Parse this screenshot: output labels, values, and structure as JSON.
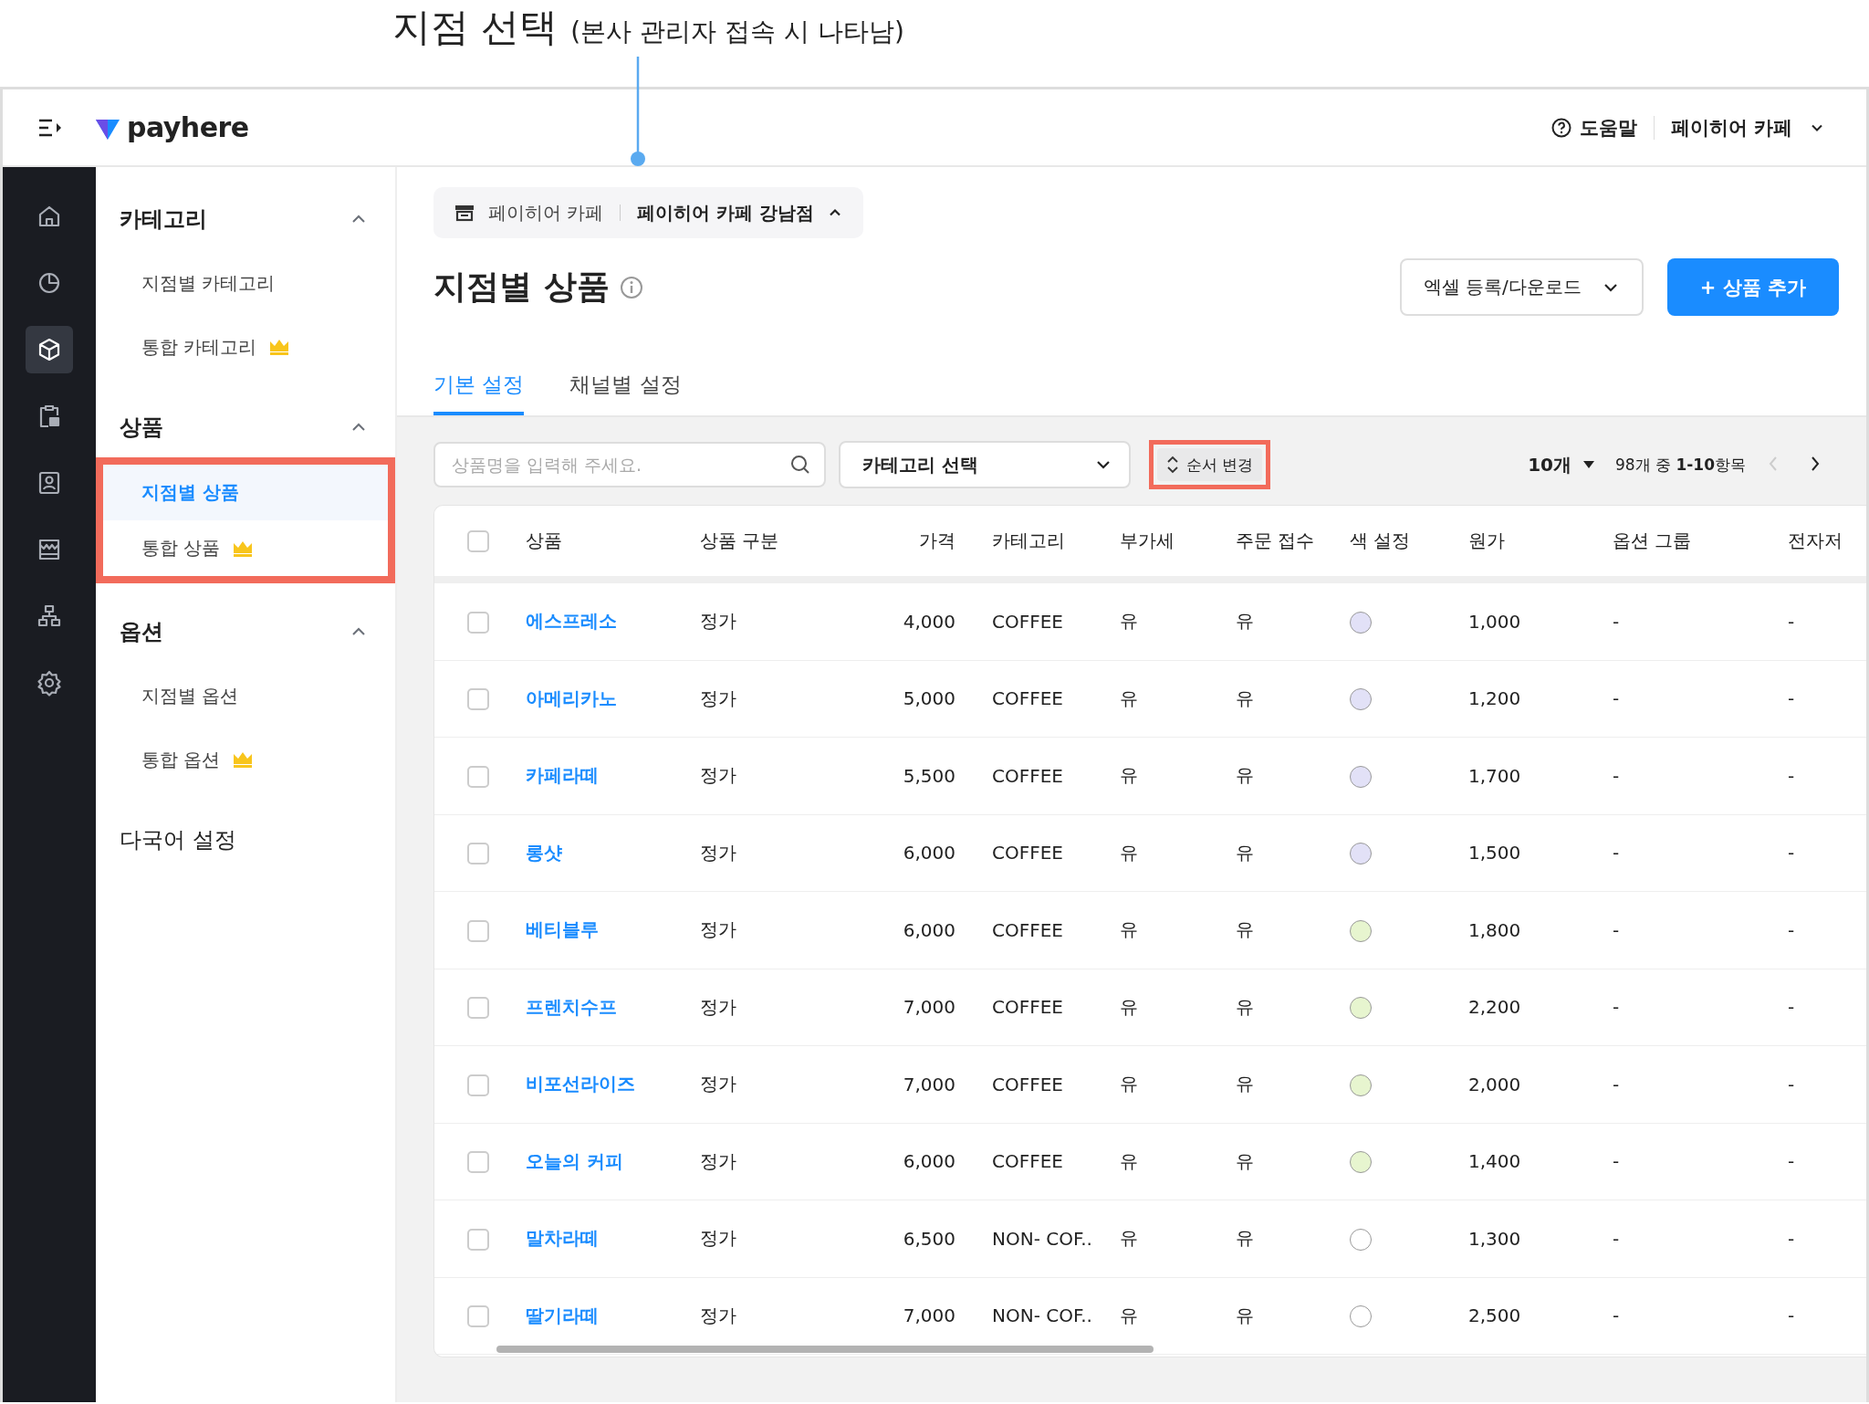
{
  "annotation": {
    "title": "지점 선택",
    "note": "(본사 관리자 접속 시 나타남)"
  },
  "header": {
    "logo": "payhere",
    "help": "도움말",
    "account": "페이히어 카페"
  },
  "rail": [
    {
      "kind": "home",
      "selected": false
    },
    {
      "kind": "chart",
      "selected": false
    },
    {
      "kind": "box",
      "selected": true
    },
    {
      "kind": "clipboard",
      "selected": false
    },
    {
      "kind": "contact",
      "selected": false
    },
    {
      "kind": "store",
      "selected": false
    },
    {
      "kind": "org",
      "selected": false
    },
    {
      "kind": "gear",
      "selected": false
    }
  ],
  "menu": [
    {
      "kind": "group",
      "title": "카테고리",
      "expanded": true,
      "highlighted": false,
      "items": [
        {
          "label": "지점별 카테고리",
          "selected": false,
          "premium": false
        },
        {
          "label": "통합 카테고리",
          "selected": false,
          "premium": true
        }
      ]
    },
    {
      "kind": "group",
      "title": "상품",
      "expanded": true,
      "highlighted": true,
      "items": [
        {
          "label": "지점별 상품",
          "selected": true,
          "premium": false
        },
        {
          "label": "통합 상품",
          "selected": false,
          "premium": true
        }
      ]
    },
    {
      "kind": "group",
      "title": "옵션",
      "expanded": true,
      "highlighted": false,
      "items": [
        {
          "label": "지점별 옵션",
          "selected": false,
          "premium": false
        },
        {
          "label": "통합 옵션",
          "selected": false,
          "premium": true
        }
      ]
    },
    {
      "kind": "link",
      "title": "다국어 설정"
    }
  ],
  "branch_selector": {
    "company": "페이히어 카페",
    "branch": "페이히어 카페 강남점",
    "expanded": true
  },
  "page": {
    "title": "지점별 상품",
    "excel_button": "엑셀 등록/다운로드",
    "add_button": "+ 상품 추가"
  },
  "tabs": [
    {
      "label": "기본 설정",
      "selected": true
    },
    {
      "label": "채널별 설정",
      "selected": false
    }
  ],
  "toolbar": {
    "search": {
      "placeholder": "상품명을 입력해 주세요."
    },
    "category": "카테고리 선택",
    "reorder": {
      "label": "순서 변경",
      "highlighted": true
    },
    "page_size": "10개",
    "range": "98개 중 **1-10**항목",
    "prev_disabled": true,
    "next_disabled": false
  },
  "table": {
    "select_all_checked": false,
    "columns": [
      "상품",
      "상품 구분",
      "가격",
      "카테고리",
      "부가세",
      "주문 접수",
      "색 설정",
      "원가",
      "옵션 그룹",
      "전자저"
    ],
    "rows": [
      {
        "checked": false,
        "name": "에스프레소",
        "type": "정가",
        "price": "4,000",
        "category": "COFFEE",
        "vat": "유",
        "order": "유",
        "color": "#e2e1f7",
        "cost": "1,000",
        "option_group": "-",
        "column_10": "-"
      },
      {
        "checked": false,
        "name": "아메리카노",
        "type": "정가",
        "price": "5,000",
        "category": "COFFEE",
        "vat": "유",
        "order": "유",
        "color": "#e2e1f7",
        "cost": "1,200",
        "option_group": "-",
        "column_10": "-"
      },
      {
        "checked": false,
        "name": "카페라떼",
        "type": "정가",
        "price": "5,500",
        "category": "COFFEE",
        "vat": "유",
        "order": "유",
        "color": "#e2e1f7",
        "cost": "1,700",
        "option_group": "-",
        "column_10": "-"
      },
      {
        "checked": false,
        "name": "롱샷",
        "type": "정가",
        "price": "6,000",
        "category": "COFFEE",
        "vat": "유",
        "order": "유",
        "color": "#e2e1f7",
        "cost": "1,500",
        "option_group": "-",
        "column_10": "-"
      },
      {
        "checked": false,
        "name": "베티블루",
        "type": "정가",
        "price": "6,000",
        "category": "COFFEE",
        "vat": "유",
        "order": "유",
        "color": "#e7f5cf",
        "cost": "1,800",
        "option_group": "-",
        "column_10": "-"
      },
      {
        "checked": false,
        "name": "프렌치수프",
        "type": "정가",
        "price": "7,000",
        "category": "COFFEE",
        "vat": "유",
        "order": "유",
        "color": "#e7f5cf",
        "cost": "2,200",
        "option_group": "-",
        "column_10": "-"
      },
      {
        "checked": false,
        "name": "비포선라이즈",
        "type": "정가",
        "price": "7,000",
        "category": "COFFEE",
        "vat": "유",
        "order": "유",
        "color": "#e7f5cf",
        "cost": "2,000",
        "option_group": "-",
        "column_10": "-"
      },
      {
        "checked": false,
        "name": "오늘의 커피",
        "type": "정가",
        "price": "6,000",
        "category": "COFFEE",
        "vat": "유",
        "order": "유",
        "color": "#e7f5cf",
        "cost": "1,400",
        "option_group": "-",
        "column_10": "-"
      },
      {
        "checked": false,
        "name": "말차라떼",
        "type": "정가",
        "price": "6,500",
        "category": "NON- COF..",
        "vat": "유",
        "order": "유",
        "color": "#ffffff",
        "cost": "1,300",
        "option_group": "-",
        "column_10": "-"
      },
      {
        "checked": false,
        "name": "딸기라떼",
        "type": "정가",
        "price": "7,000",
        "category": "NON- COF..",
        "vat": "유",
        "order": "유",
        "color": "#ffffff",
        "cost": "2,500",
        "option_group": "-",
        "column_10": "-"
      }
    ]
  }
}
